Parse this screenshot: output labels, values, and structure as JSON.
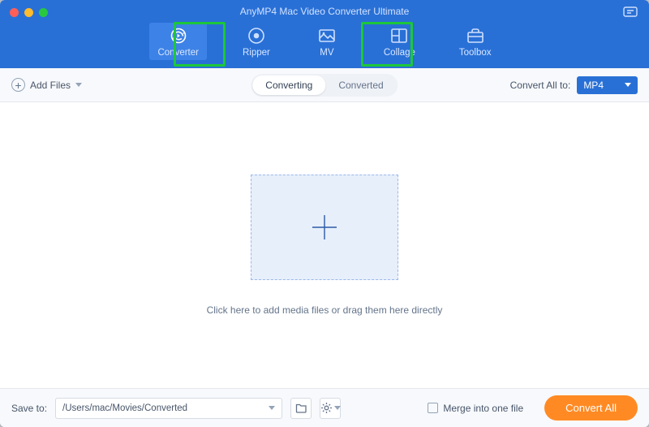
{
  "app_title": "AnyMP4 Mac Video Converter Ultimate",
  "nav": {
    "converter": "Converter",
    "ripper": "Ripper",
    "mv": "MV",
    "collage": "Collage",
    "toolbox": "Toolbox"
  },
  "subbar": {
    "add_files": "Add Files",
    "tab_converting": "Converting",
    "tab_converted": "Converted",
    "convert_all_to": "Convert All to:",
    "format": "MP4"
  },
  "main": {
    "hint": "Click here to add media files or drag them here directly"
  },
  "footer": {
    "save_to_label": "Save to:",
    "path": "/Users/mac/Movies/Converted",
    "merge_label": "Merge into one file",
    "convert_all": "Convert All"
  }
}
